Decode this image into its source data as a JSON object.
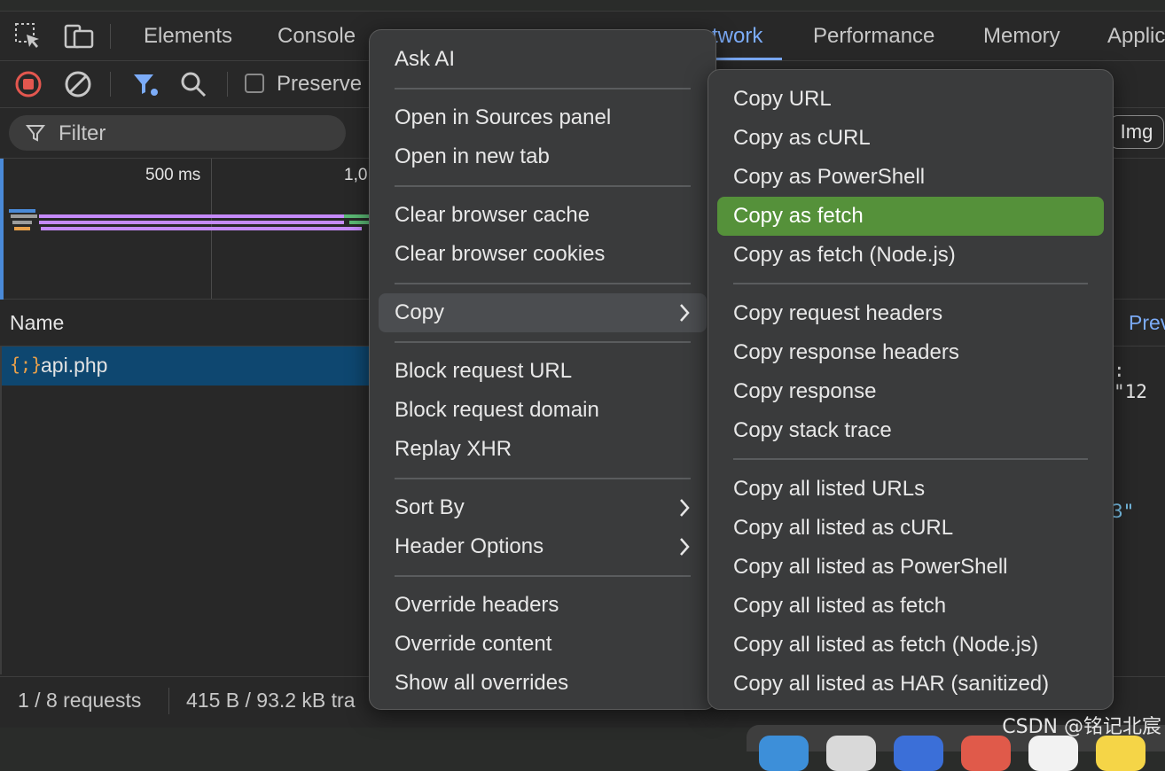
{
  "tabs": {
    "elements": "Elements",
    "console": "Console",
    "network": "twork",
    "performance": "Performance",
    "memory": "Memory",
    "application": "Applic"
  },
  "toolbar": {
    "preserve_label": "Preserve"
  },
  "filter": {
    "placeholder": "Filter",
    "img_chip": "Img"
  },
  "overview": {
    "tick_500": "500 ms",
    "tick_1000": "1,0"
  },
  "table": {
    "name_header": "Name",
    "preview_tab": "Prev",
    "rows": [
      {
        "icon": "{;}",
        "name": "api.php"
      }
    ]
  },
  "response_fragments": {
    "top": ":  \"12",
    "mid": "3\""
  },
  "status": {
    "requests": "1 / 8 requests",
    "transferred": "415 B / 93.2 kB tra"
  },
  "context_menu": {
    "ask_ai": "Ask AI",
    "open_sources": "Open in Sources panel",
    "open_new_tab": "Open in new tab",
    "clear_cache": "Clear browser cache",
    "clear_cookies": "Clear browser cookies",
    "copy": "Copy",
    "block_url": "Block request URL",
    "block_domain": "Block request domain",
    "replay_xhr": "Replay XHR",
    "sort_by": "Sort By",
    "header_options": "Header Options",
    "override_headers": "Override headers",
    "override_content": "Override content",
    "show_overrides": "Show all overrides"
  },
  "copy_submenu": {
    "copy_url": "Copy URL",
    "copy_curl": "Copy as cURL",
    "copy_powershell": "Copy as PowerShell",
    "copy_fetch": "Copy as fetch",
    "copy_fetch_node": "Copy as fetch (Node.js)",
    "copy_req_headers": "Copy request headers",
    "copy_resp_headers": "Copy response headers",
    "copy_response": "Copy response",
    "copy_stack": "Copy stack trace",
    "copy_all_urls": "Copy all listed URLs",
    "copy_all_curl": "Copy all listed as cURL",
    "copy_all_powershell": "Copy all listed as PowerShell",
    "copy_all_fetch": "Copy all listed as fetch",
    "copy_all_fetch_node": "Copy all listed as fetch (Node.js)",
    "copy_all_har": "Copy all listed as HAR (sanitized)"
  },
  "watermark": "CSDN @铭记北宸",
  "colors": {
    "accent_blue": "#7cacf8",
    "highlight_green": "#55913a",
    "selected_row": "#0e4770",
    "record_red": "#e4574f"
  }
}
